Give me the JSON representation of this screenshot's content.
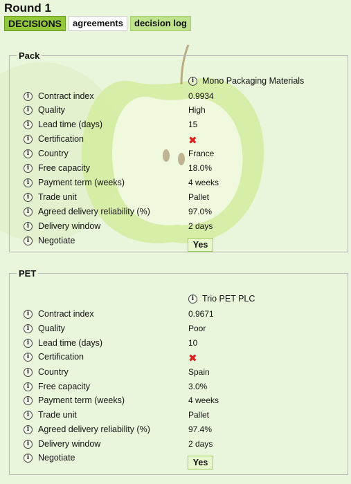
{
  "header": {
    "round_title": "Round 1",
    "tabs": [
      {
        "label": "DECISIONS"
      },
      {
        "label": "agreements"
      },
      {
        "label": "decision log"
      }
    ]
  },
  "icons": {
    "info": "info-icon",
    "cross": "cross-icon"
  },
  "colors": {
    "accent": "#93c83b",
    "cross": "#e02020",
    "yes_bg": "#e8f7cc"
  },
  "sections": [
    {
      "title": "Pack",
      "supplier": "Mono Packaging Materials",
      "rows": [
        {
          "label": "Contract index",
          "value": "0.9934"
        },
        {
          "label": "Quality",
          "value": "High"
        },
        {
          "label": "Lead time (days)",
          "value": "15"
        },
        {
          "label": "Certification",
          "value": "✖"
        },
        {
          "label": "Country",
          "value": "France"
        },
        {
          "label": "Free capacity",
          "value": "18.0%"
        },
        {
          "label": "Payment term (weeks)",
          "value": "4 weeks"
        },
        {
          "label": "Trade unit",
          "value": "Pallet"
        },
        {
          "label": "Agreed delivery reliability (%)",
          "value": "97.0%"
        },
        {
          "label": "Delivery window",
          "value": "2 days"
        },
        {
          "label": "Negotiate",
          "value": "Yes"
        }
      ]
    },
    {
      "title": "PET",
      "supplier": "Trio PET PLC",
      "rows": [
        {
          "label": "Contract index",
          "value": "0.9671"
        },
        {
          "label": "Quality",
          "value": "Poor"
        },
        {
          "label": "Lead time (days)",
          "value": "10"
        },
        {
          "label": "Certification",
          "value": "✖"
        },
        {
          "label": "Country",
          "value": "Spain"
        },
        {
          "label": "Free capacity",
          "value": "3.0%"
        },
        {
          "label": "Payment term (weeks)",
          "value": "4 weeks"
        },
        {
          "label": "Trade unit",
          "value": "Pallet"
        },
        {
          "label": "Agreed delivery reliability (%)",
          "value": "97.4%"
        },
        {
          "label": "Delivery window",
          "value": "2 days"
        },
        {
          "label": "Negotiate",
          "value": "Yes"
        }
      ]
    }
  ]
}
